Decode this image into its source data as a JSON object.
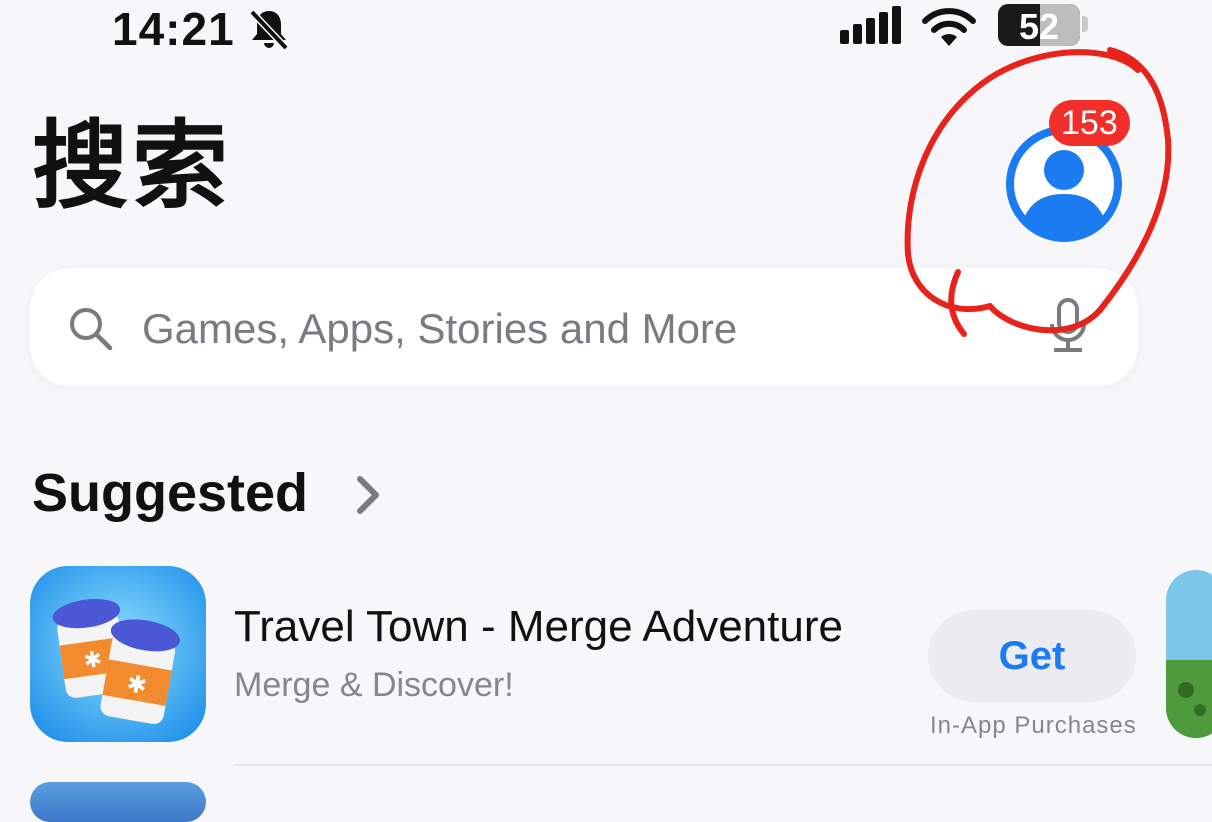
{
  "status_bar": {
    "time": "14:21",
    "battery": "52",
    "icons": [
      "bell-muted-icon",
      "cellular-signal-icon",
      "wifi-icon",
      "battery-icon"
    ]
  },
  "header": {
    "title": "搜索",
    "account_badge": "153"
  },
  "search": {
    "placeholder": "Games, Apps, Stories and More",
    "value": ""
  },
  "suggested": {
    "title": "Suggested",
    "apps": [
      {
        "name": "Travel Town - Merge Adventure",
        "subtitle": "Merge & Discover!",
        "action": "Get",
        "note": "In-App Purchases"
      }
    ]
  },
  "colors": {
    "accent": "#1a7cf0",
    "badge": "#f22e2a",
    "annotation": "#e8231c",
    "background": "#f7f7f9"
  }
}
